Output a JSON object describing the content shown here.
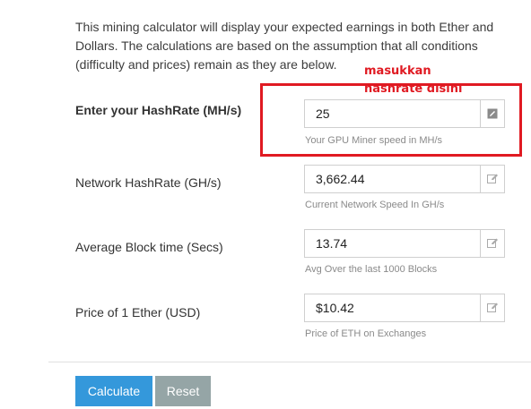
{
  "intro": "This mining calculator will display your expected earnings in both Ether and Dollars. The calculations are based on the assumption that all conditions (difficulty and prices) remain as they are below.",
  "annotation": {
    "line1": "masukkan",
    "line2": "hashrate disini",
    "color": "#e01a22"
  },
  "fields": [
    {
      "label": "Enter your HashRate (MH/s)",
      "value": "25",
      "help": "Your GPU Miner speed in MH/s"
    },
    {
      "label": "Network HashRate (GH/s)",
      "value": "3,662.44",
      "help": "Current Network Speed In GH/s"
    },
    {
      "label": "Average Block time (Secs)",
      "value": "13.74",
      "help": "Avg Over the last 1000 Blocks"
    },
    {
      "label": "Price of 1 Ether (USD)",
      "value": "$10.42",
      "help": "Price of ETH on Exchanges"
    }
  ],
  "buttons": {
    "calculate": "Calculate",
    "reset": "Reset",
    "calculate_color": "#3498db",
    "reset_color": "#95a5a6"
  },
  "icons": {
    "field_addon": "edit-icon"
  }
}
